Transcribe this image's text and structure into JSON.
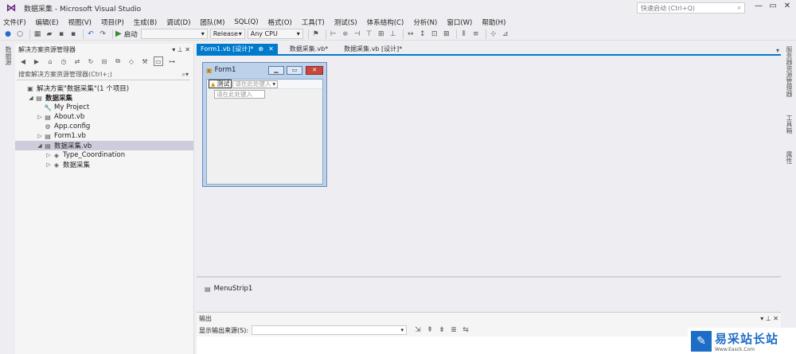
{
  "window": {
    "title": "数据采集 - Microsoft Visual Studio",
    "quick_launch_placeholder": "快速启动 (Ctrl+Q)",
    "minimize": "—",
    "restore": "▭",
    "close": "✕"
  },
  "menu": [
    "文件(F)",
    "编辑(E)",
    "视图(V)",
    "项目(P)",
    "生成(B)",
    "调试(D)",
    "团队(M)",
    "SQL(Q)",
    "格式(O)",
    "工具(T)",
    "测试(S)",
    "体系结构(C)",
    "分析(N)",
    "窗口(W)",
    "帮助(H)"
  ],
  "toolbar": {
    "start_label": "启动",
    "configuration": "Release",
    "platform": "Any CPU"
  },
  "left_strip": {
    "tabs": [
      "数据源"
    ]
  },
  "right_strip": {
    "tabs": [
      "服务器资源管理器",
      "工具箱",
      "属性"
    ]
  },
  "solution_explorer": {
    "title": "解决方案资源管理器",
    "search_placeholder": "搜索解决方案资源管理器(Ctrl+;)",
    "tree": [
      {
        "label": "解决方案\"数据采集\"(1 个项目)",
        "indent": 0,
        "arrow": "",
        "icon": "▣",
        "bold": false,
        "selected": false
      },
      {
        "label": "数据采集",
        "indent": 1,
        "arrow": "◢",
        "icon": "▤",
        "bold": true,
        "selected": false
      },
      {
        "label": "My Project",
        "indent": 2,
        "arrow": "",
        "icon": "🔧",
        "bold": false,
        "selected": false
      },
      {
        "label": "About.vb",
        "indent": 2,
        "arrow": "▷",
        "icon": "▤",
        "bold": false,
        "selected": false
      },
      {
        "label": "App.config",
        "indent": 2,
        "arrow": "",
        "icon": "⚙",
        "bold": false,
        "selected": false
      },
      {
        "label": "Form1.vb",
        "indent": 2,
        "arrow": "▷",
        "icon": "▤",
        "bold": false,
        "selected": false
      },
      {
        "label": "数据采集.vb",
        "indent": 2,
        "arrow": "◢",
        "icon": "▤",
        "bold": false,
        "selected": true
      },
      {
        "label": "Type_Coordination",
        "indent": 3,
        "arrow": "▷",
        "icon": "◈",
        "bold": false,
        "selected": false
      },
      {
        "label": "数据采集",
        "indent": 3,
        "arrow": "▷",
        "icon": "◈",
        "bold": false,
        "selected": false
      }
    ]
  },
  "tabs": [
    {
      "label": "Form1.vb [设计]*",
      "active": true
    },
    {
      "label": "数据采集.vb*",
      "active": false
    },
    {
      "label": "数据采集.vb [设计]*",
      "active": false
    }
  ],
  "designer": {
    "form_title": "Form1",
    "menu_item": "测试",
    "menu_placeholder": "请在此处键入",
    "submenu_placeholder": "请在此处键入"
  },
  "tray": {
    "component": "MenuStrip1"
  },
  "output": {
    "title": "输出",
    "source_label": "显示输出来源(S):",
    "source_value": ""
  },
  "watermark": {
    "text": "易采站长站",
    "url": "Www.Easck.Com"
  },
  "colors": {
    "accent": "#007acc",
    "ide_background": "#eeeef2",
    "selection": "#ccccdc"
  }
}
